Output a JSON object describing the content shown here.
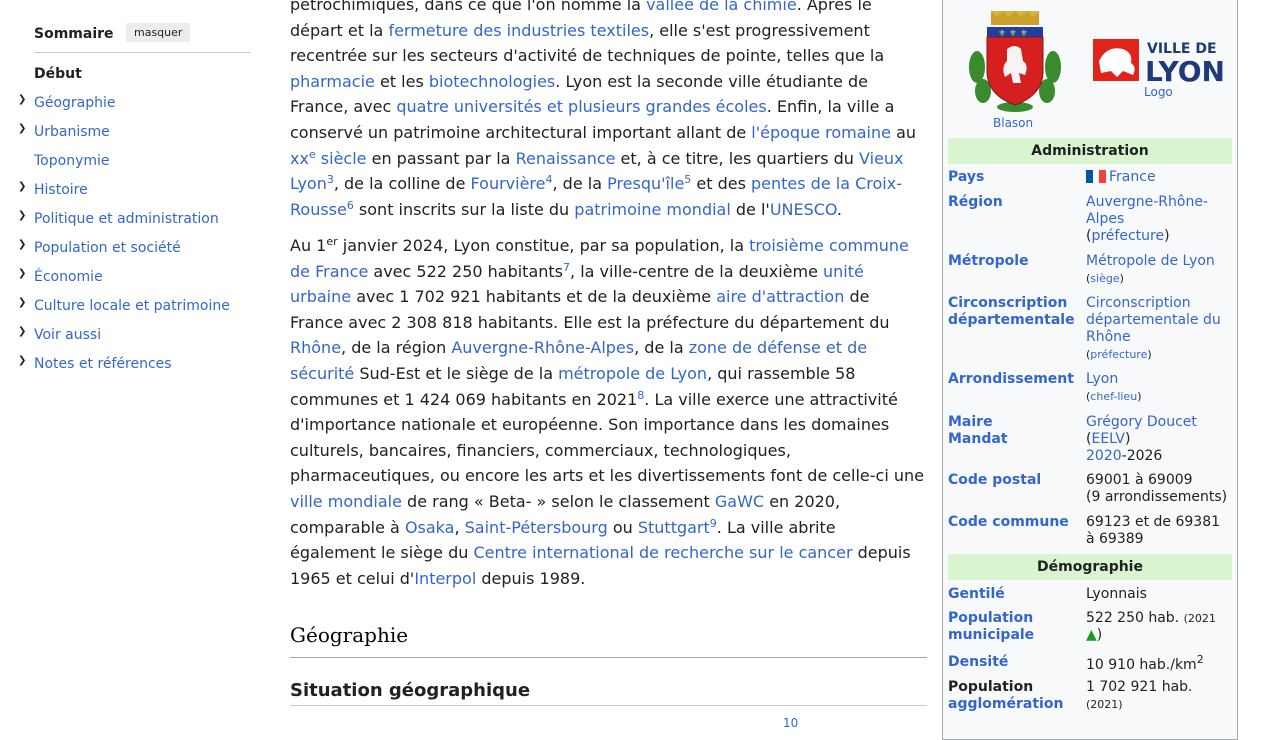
{
  "toc": {
    "title": "Sommaire",
    "hide_label": "masquer",
    "items": [
      {
        "label": "Début",
        "expandable": false,
        "active": true
      },
      {
        "label": "Géographie",
        "expandable": true
      },
      {
        "label": "Urbanisme",
        "expandable": true
      },
      {
        "label": "Toponymie",
        "expandable": false
      },
      {
        "label": "Histoire",
        "expandable": true
      },
      {
        "label": "Politique et administration",
        "expandable": true
      },
      {
        "label": "Population et société",
        "expandable": true
      },
      {
        "label": "Économie",
        "expandable": true
      },
      {
        "label": "Culture locale et patrimoine",
        "expandable": true
      },
      {
        "label": "Voir aussi",
        "expandable": true
      },
      {
        "label": "Notes et références",
        "expandable": true
      }
    ]
  },
  "article": {
    "para1": {
      "l0": [
        "pétrochimiques, dans ce que l'on nomme la ",
        "vallée de la chimie",
        ". Après le"
      ],
      "l1": [
        "départ et la ",
        "fermeture des industries textiles",
        ", elle s'est progressivement"
      ],
      "l2": [
        "recentrée sur les secteurs d'activité de techniques de pointe, telles que la"
      ],
      "l3": [
        "pharmacie",
        " et les ",
        "biotechnologies",
        ". Lyon est la seconde ville étudiante de"
      ],
      "l4": [
        "France, avec ",
        "quatre universités et plusieurs grandes écoles",
        ". Enfin, la ville a"
      ],
      "l5": [
        "conservé un patrimoine architectural important allant de ",
        "l'époque romaine",
        " au"
      ],
      "l6": [
        "xx",
        "e",
        " siècle",
        " en passant par la ",
        "Renaissance",
        " et, à ce titre, les quartiers du ",
        "Vieux"
      ],
      "l7": [
        "Lyon",
        "3",
        ", de la colline de ",
        "Fourvière",
        "4",
        ", de la ",
        "Presqu'île",
        "5",
        " et des ",
        "pentes de la Croix-"
      ],
      "l8": [
        "Rousse",
        "6",
        " sont inscrits sur la liste du ",
        "patrimoine mondial",
        " de l'",
        "UNESCO",
        "."
      ]
    },
    "para2": {
      "l0": [
        "Au 1",
        "er",
        " janvier 2024, Lyon constitue, par sa population, la ",
        "troisième commune"
      ],
      "l1": [
        "de France",
        " avec 522 250 habitants",
        "7",
        ", la ville-centre de la deuxième ",
        "unité"
      ],
      "l2": [
        "urbaine",
        " avec 1 702 921 habitants et de la deuxième ",
        "aire d'attraction",
        " de"
      ],
      "l3": [
        "France avec 2 308 818 habitants. Elle est la préfecture du département du"
      ],
      "l4": [
        "Rhône",
        ", de la région ",
        "Auvergne-Rhône-Alpes",
        ", de la ",
        "zone de défense et de"
      ],
      "l5": [
        "sécurité",
        " Sud-Est et le siège de la ",
        "métropole de Lyon",
        ", qui rassemble 58"
      ],
      "l6": [
        "communes et 1 424 069 habitants en 2021",
        "8",
        ". La ville exerce une attractivité"
      ],
      "l7": [
        "d'importance nationale et européenne. Son importance dans les domaines"
      ],
      "l8": [
        "culturels, bancaires, financiers, commerciaux, technologiques,"
      ],
      "l9": [
        "pharmaceutiques, ou encore les arts et les divertissements font de celle-ci une"
      ],
      "l10": [
        "ville mondiale",
        " de rang « Beta- » selon le classement ",
        "GaWC",
        " en 2020,"
      ],
      "l11": [
        "comparable à ",
        "Osaka",
        ", ",
        "Saint-Pétersbourg",
        " ou ",
        "Stuttgart",
        "9",
        ". La ville abrite"
      ],
      "l12": [
        "également le siège du ",
        "Centre international de recherche sur le cancer",
        " depuis"
      ],
      "l13": [
        "1965 et celui d'",
        "Interpol",
        " depuis 1989."
      ]
    },
    "heading_geo": "Géographie",
    "heading_situation": "Situation géographique",
    "cut_ref": "10"
  },
  "infobox": {
    "coa_caption": "Blason",
    "logo_text_top": "VILLE DE",
    "logo_text_bottom": "LYON",
    "logo_caption": "Logo",
    "section_admin": "Administration",
    "section_demo": "Démographie",
    "rows": {
      "pays": {
        "label": "Pays",
        "value": "France"
      },
      "region": {
        "label": "Région",
        "value_l1": "Auvergne-Rhône-",
        "value_l2": "Alpes",
        "paren_open": "(",
        "paren_link": "préfecture",
        "paren_close": ")"
      },
      "metropole": {
        "label": "Métropole",
        "value": "Métropole de Lyon",
        "paren_open": "(",
        "paren_link": "siège",
        "paren_close": ")"
      },
      "circo": {
        "label_l1": "Circonscription",
        "label_l2": "départementale",
        "value_l1": "Circonscription",
        "value_l2": "départementale du",
        "value_l3": "Rhône",
        "paren_open": "(",
        "paren_link": "préfecture",
        "paren_close": ")"
      },
      "arrond": {
        "label": "Arrondissement",
        "value": "Lyon",
        "paren_open": "(",
        "paren_link": "chef-lieu",
        "paren_close": ")"
      },
      "maire": {
        "label_l1": "Maire",
        "label_l2": "Mandat",
        "value": "Grégory Doucet",
        "party_open": "(",
        "party": "EELV",
        "party_close": ")",
        "term_start": "2020",
        "term_end": "-2026"
      },
      "cp": {
        "label": "Code postal",
        "value_l1": "69001 à 69009",
        "value_l2": "(9 arrondissements)"
      },
      "commune": {
        "label": "Code commune",
        "value_l1": "69123 et de 69381",
        "value_l2": "à 69389"
      },
      "gentile": {
        "label": "Gentilé",
        "value": "Lyonnais"
      },
      "popmun": {
        "label_l1": "Population",
        "label_l2": "municipale",
        "value": "522 250 hab.",
        "year_open": "(2021",
        "arrow": "▲",
        "year_close": ")"
      },
      "densite": {
        "label": "Densité",
        "value": "10 910 hab./km",
        "sup": "2"
      },
      "popagg": {
        "label_l1": "Population",
        "label_l2": "agglomération",
        "value": "1 702 921 hab.",
        "year": "(2021)"
      }
    }
  }
}
